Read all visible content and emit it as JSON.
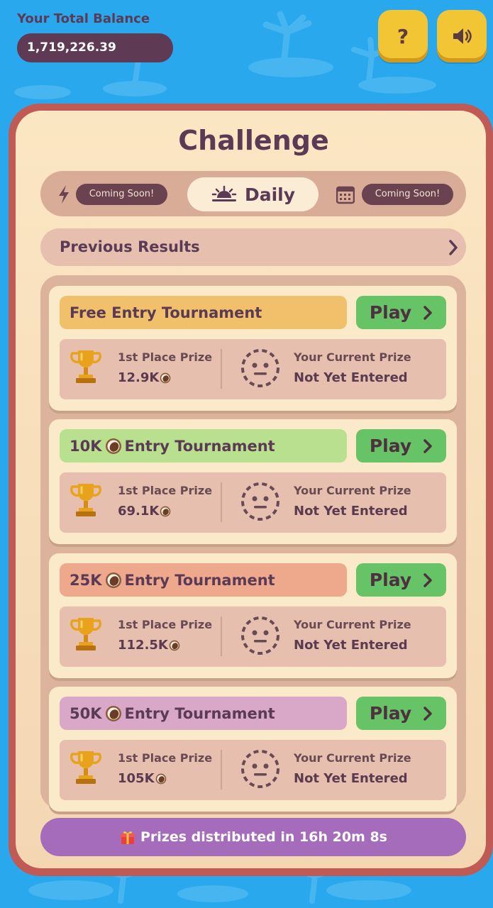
{
  "header": {
    "balance_label": "Your Total Balance",
    "balance_value": "1,719,226.39",
    "help_icon": "question-mark-icon",
    "sound_icon": "speaker-icon"
  },
  "colors": {
    "background": "#29a8ee",
    "card_border": "#c05a54",
    "card_fill": "#fbe6c3",
    "play_button": "#66c466",
    "footer": "#a66cbc",
    "header_free": "#f0c06a",
    "header_10k": "#b8e08e",
    "header_25k": "#eea88c",
    "header_50k": "#d9a8c9"
  },
  "challenge": {
    "title": "Challenge",
    "tabs": [
      {
        "icon": "lightning-icon",
        "label": "Coming Soon!"
      },
      {
        "icon": "sunrise-icon",
        "label": "Daily"
      },
      {
        "icon": "calendar-icon",
        "label": "Coming Soon!"
      }
    ],
    "previous_results_label": "Previous Results",
    "tournaments": [
      {
        "title_prefix": "Free Entry Tournament",
        "title_suffix": "",
        "has_coin": false,
        "play_label": "Play",
        "first_prize_label": "1st Place Prize",
        "first_prize_value": "12.9K",
        "current_prize_label": "Your Current Prize",
        "current_prize_value": "Not Yet Entered"
      },
      {
        "title_prefix": "10K",
        "title_suffix": "Entry Tournament",
        "has_coin": true,
        "play_label": "Play",
        "first_prize_label": "1st Place Prize",
        "first_prize_value": "69.1K",
        "current_prize_label": "Your Current Prize",
        "current_prize_value": "Not Yet Entered"
      },
      {
        "title_prefix": "25K",
        "title_suffix": "Entry Tournament",
        "has_coin": true,
        "play_label": "Play",
        "first_prize_label": "1st Place Prize",
        "first_prize_value": "112.5K",
        "current_prize_label": "Your Current Prize",
        "current_prize_value": "Not Yet Entered"
      },
      {
        "title_prefix": "50K",
        "title_suffix": "Entry Tournament",
        "has_coin": true,
        "play_label": "Play",
        "first_prize_label": "1st Place Prize",
        "first_prize_value": "105K",
        "current_prize_label": "Your Current Prize",
        "current_prize_value": "Not Yet Entered"
      }
    ],
    "footer_icon": "gift-icon",
    "footer_text": "Prizes distributed in 16h 20m 8s"
  }
}
